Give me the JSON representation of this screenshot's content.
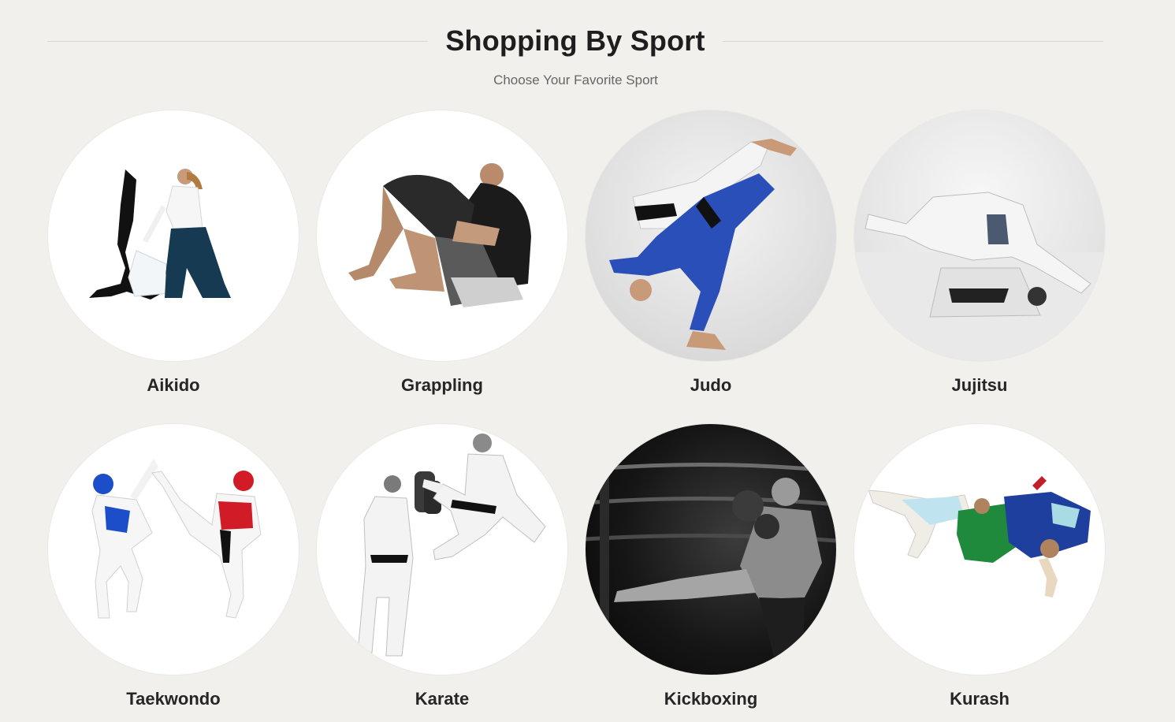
{
  "section": {
    "title": "Shopping By Sport",
    "subtitle": "Choose Your Favorite Sport"
  },
  "sports": [
    {
      "label": "Aikido",
      "icon": "aikido-throw-photo"
    },
    {
      "label": "Grappling",
      "icon": "grappling-guard-photo"
    },
    {
      "label": "Judo",
      "icon": "judo-throw-photo"
    },
    {
      "label": "Jujitsu",
      "icon": "jujitsu-mount-photo"
    },
    {
      "label": "Taekwondo",
      "icon": "taekwondo-kick-photo"
    },
    {
      "label": "Karate",
      "icon": "karate-flying-kick-photo"
    },
    {
      "label": "Kickboxing",
      "icon": "kickboxing-kick-photo"
    },
    {
      "label": "Kurash",
      "icon": "kurash-throw-photo"
    }
  ],
  "colors": {
    "background": "#f2f0ec",
    "heading": "#1e1e1e",
    "subtitle": "#666666",
    "judo_blue": "#2a4fb8",
    "taekwondo_red": "#d11b27",
    "taekwondo_blue": "#1d4ec9",
    "kurash_green": "#1f8a3c",
    "hakama_navy": "#183a55"
  }
}
